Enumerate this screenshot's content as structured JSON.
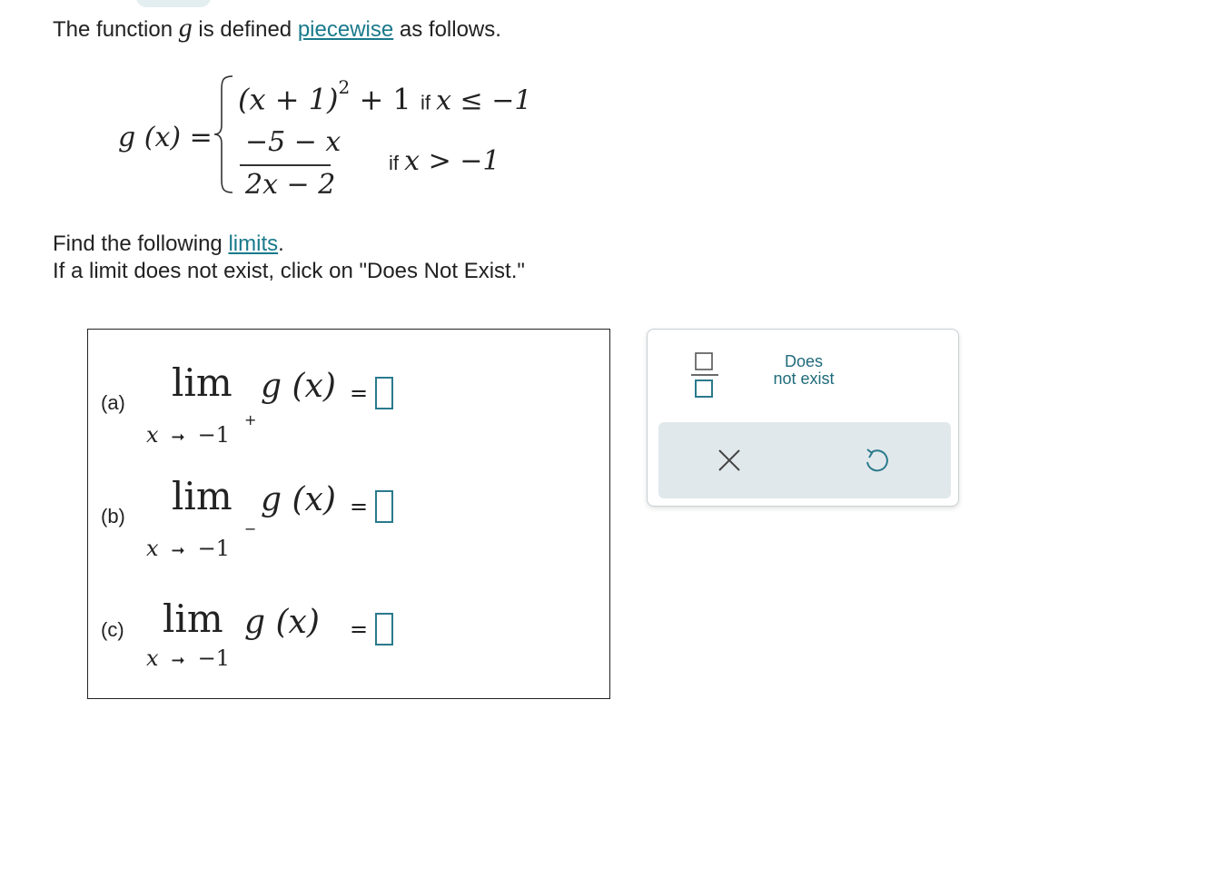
{
  "intro": {
    "prefix": "The function ",
    "variable": "g",
    "middle": " is defined ",
    "link": "piecewise",
    "suffix": " as follows."
  },
  "piecewise": {
    "lhs": "g (x) =",
    "case1_expr_base": "(x + 1)",
    "case1_expr_exp": "2",
    "case1_expr_tail": " + 1",
    "case1_if": "if ",
    "case1_cond": "x ≤ −1",
    "case2_numerator": "−5 − x",
    "case2_denominator": "2x − 2",
    "case2_if": "if ",
    "case2_cond": "x > −1"
  },
  "instructions": {
    "line1_prefix": "Find the following ",
    "line1_link": "limits",
    "line1_suffix": ".",
    "line2": "If a limit does not exist, click on \"Does Not Exist.\""
  },
  "parts": [
    {
      "label": "(a)",
      "lim": "lim",
      "fn": "g (x)",
      "var": "x",
      "target": "−1",
      "side": "+",
      "equals": "="
    },
    {
      "label": "(b)",
      "lim": "lim",
      "fn": "g (x)",
      "var": "x",
      "target": "−1",
      "side": "−",
      "equals": "="
    },
    {
      "label": "(c)",
      "lim": "lim",
      "fn": "g (x)",
      "var": "x",
      "target": "−1",
      "side": "",
      "equals": "="
    }
  ],
  "palette": {
    "fraction_icon": "fraction-template-icon",
    "dne_line1": "Does",
    "dne_line2": "not exist",
    "clear_icon": "close-icon",
    "undo_icon": "undo-icon"
  },
  "colors": {
    "accent": "#1a7a8c",
    "answer_box_border": "#2a7a8c",
    "action_bar": "#e1e8eb"
  }
}
